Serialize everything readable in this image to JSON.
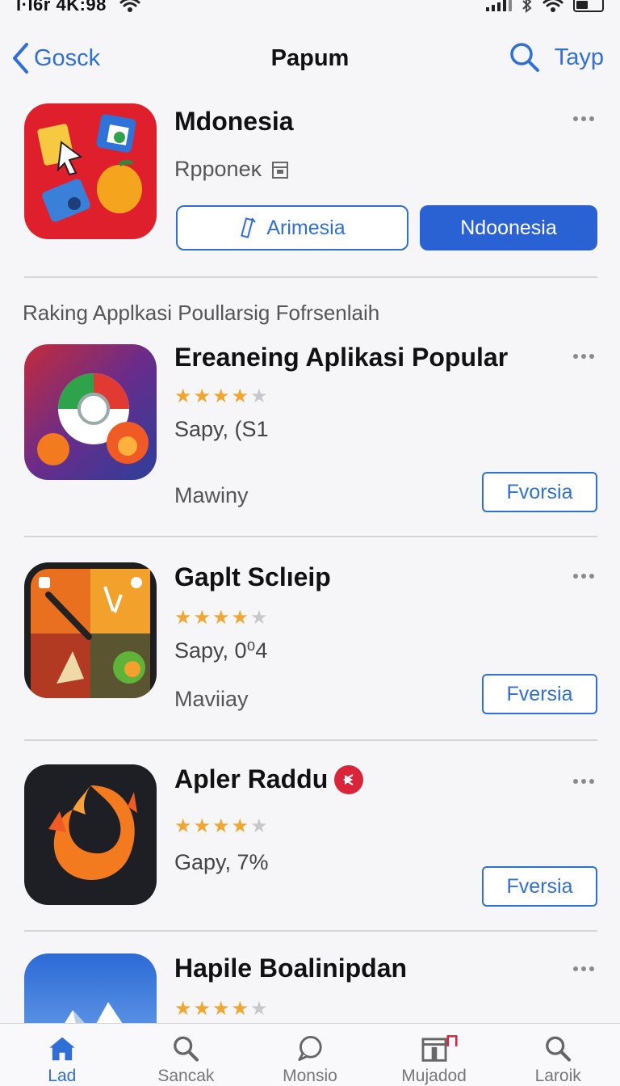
{
  "status_bar": {
    "time": "Ι·Ι6r 4K:98"
  },
  "nav": {
    "back_label": "Gosck",
    "title": "Papum",
    "right_label": "Tayp"
  },
  "featured": {
    "name": "Mdonesia",
    "subtitle": "Rpponeĸ",
    "outline_button": "Arimesia",
    "solid_button": "Ndoonesia"
  },
  "section_title": "Raking Applkasi Poullarsig Fofrsenlaih",
  "apps": [
    {
      "title": "Ereaneing Aplikasi Popular",
      "rating": 4,
      "sub": "Sapy, (S1",
      "meta": "Mawiny",
      "button": "Fvorsia"
    },
    {
      "title": "Gaplt Sclıeip",
      "rating": 4,
      "sub": "Sapy, 0⁰4",
      "meta": "Maviiay",
      "button": "Fversia"
    },
    {
      "title": "Apler Raddu",
      "rating": 4,
      "sub": "Gapy, 7%",
      "meta": "",
      "button": "Fversia"
    },
    {
      "title": "Hapile Boalinipdan",
      "rating": 4,
      "sub": "",
      "meta": "",
      "button": ""
    }
  ],
  "tabs": [
    {
      "label": "Lad",
      "icon": "home-icon"
    },
    {
      "label": "Sancak",
      "icon": "search-icon"
    },
    {
      "label": "Monsio",
      "icon": "chat-icon"
    },
    {
      "label": "Mujadod",
      "icon": "box-icon"
    },
    {
      "label": "Laroik",
      "icon": "search-icon"
    }
  ],
  "colors": {
    "accent": "#2f6fd6",
    "solid_button": "#2a62d3",
    "star": "#f0a630",
    "badge": "#d9243a"
  }
}
